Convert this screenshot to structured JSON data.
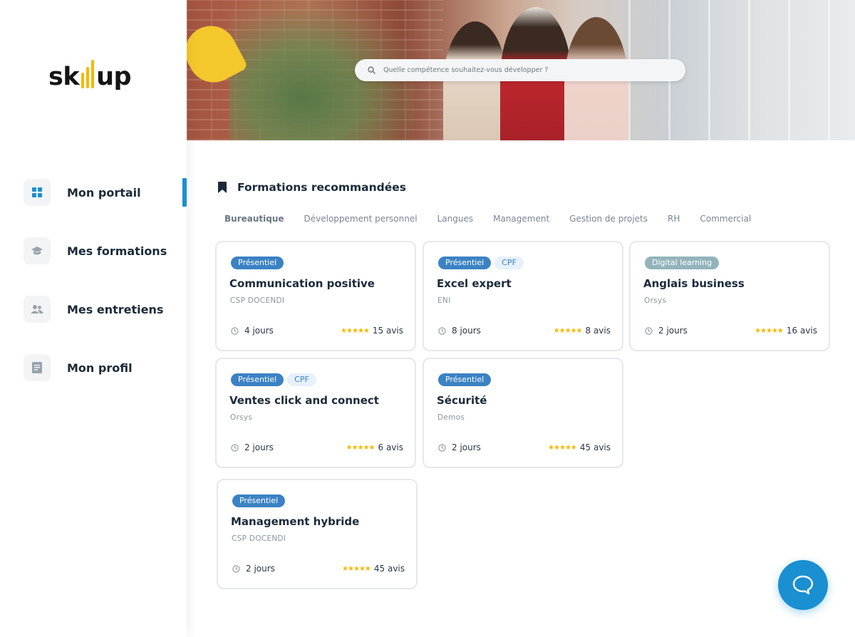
{
  "brand": {
    "logo_start": "sk",
    "logo_end": "up",
    "accent": "#1a8fd1",
    "logo_accent": "#f5b800"
  },
  "sidebar": {
    "items": [
      {
        "label": "Mon portail",
        "icon": "grid-icon",
        "active": true
      },
      {
        "label": "Mes formations",
        "icon": "graduation-cap-icon",
        "active": false
      },
      {
        "label": "Mes entretiens",
        "icon": "users-icon",
        "active": false
      },
      {
        "label": "Mon profil",
        "icon": "document-icon",
        "active": false
      }
    ]
  },
  "search": {
    "placeholder": "Quelle compétence souhaitez-vous développer ?"
  },
  "main": {
    "section_title": "Formations recommandées",
    "tabs": [
      {
        "label": "Bureautique",
        "active": true
      },
      {
        "label": "Développement personnel",
        "active": false
      },
      {
        "label": "Langues",
        "active": false
      },
      {
        "label": "Management",
        "active": false
      },
      {
        "label": "Gestion de projets",
        "active": false
      },
      {
        "label": "RH",
        "active": false
      },
      {
        "label": "Commercial",
        "active": false
      }
    ],
    "cards": [
      {
        "tags": [
          "Présentiel"
        ],
        "title": "Communication positive",
        "provider": "CSP DOCENDI",
        "duration": "4 jours",
        "stars": "★★★★★",
        "rating": 5,
        "reviews": "15 avis"
      },
      {
        "tags": [
          "Présentiel",
          "CPF"
        ],
        "title": "Excel expert",
        "provider": "ENI",
        "duration": "8 jours",
        "stars": "★★★★★",
        "rating": 4.5,
        "reviews": "8 avis"
      },
      {
        "tags": [
          "Digital learning"
        ],
        "title": "Anglais business",
        "provider": "Orsys",
        "duration": "2 jours",
        "stars": "★★★★★",
        "rating": 5,
        "reviews": "16 avis"
      },
      {
        "tags": [
          "Présentiel",
          "CPF"
        ],
        "title": "Ventes click and connect",
        "provider": "Orsys",
        "duration": "2 jours",
        "stars": "★★★★★",
        "rating": 4.5,
        "reviews": "6 avis"
      },
      {
        "tags": [
          "Présentiel"
        ],
        "title": "Sécurité",
        "provider": "Demos",
        "duration": "2 jours",
        "stars": "★★★★★",
        "rating": 5,
        "reviews": "45 avis"
      },
      {
        "tags": [
          "Présentiel"
        ],
        "title": "Management hybride",
        "provider": "CSP DOCENDI",
        "duration": "2 jours",
        "stars": "★★★★★",
        "rating": 5,
        "reviews": "45 avis"
      }
    ]
  },
  "chat": {
    "icon": "chat-bubble-icon"
  }
}
